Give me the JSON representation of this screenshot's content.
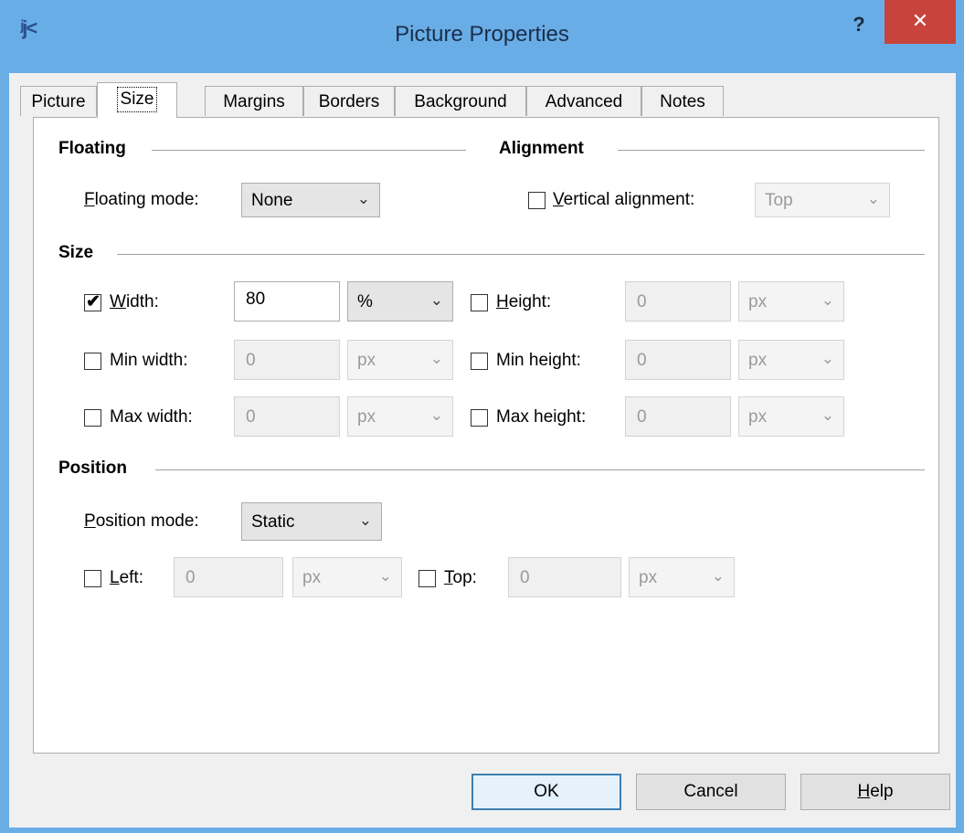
{
  "window": {
    "logo": "ʲj˂",
    "title": "Picture Properties",
    "help_glyph": "?",
    "close_glyph": "✕"
  },
  "tabs": [
    {
      "label": "Picture",
      "active": false
    },
    {
      "label": "Size",
      "active": true
    },
    {
      "label": "Margins",
      "active": false
    },
    {
      "label": "Borders",
      "active": false
    },
    {
      "label": "Background",
      "active": false
    },
    {
      "label": "Advanced",
      "active": false
    },
    {
      "label": "Notes",
      "active": false
    }
  ],
  "floating": {
    "section_title": "Floating",
    "mode_label_ul": "F",
    "mode_label_rest": "loating mode:",
    "mode_value": "None"
  },
  "alignment": {
    "section_title": "Alignment",
    "vertical_label_ul": "V",
    "vertical_label_rest": "ertical alignment:",
    "vertical_checked": false,
    "vertical_value": "Top"
  },
  "size": {
    "section_title": "Size",
    "width_label_ul": "W",
    "width_label_rest": "idth:",
    "width_checked": true,
    "width_value": "80",
    "width_unit": "%",
    "height_label_ul": "H",
    "height_label_rest": "eight:",
    "height_checked": false,
    "height_value": "0",
    "height_unit": "px",
    "min_width_label": "Min width:",
    "min_width_value": "0",
    "min_width_unit": "px",
    "min_height_label": "Min height:",
    "min_height_value": "0",
    "min_height_unit": "px",
    "max_width_label": "Max width:",
    "max_width_value": "0",
    "max_width_unit": "px",
    "max_height_label": "Max height:",
    "max_height_value": "0",
    "max_height_unit": "px"
  },
  "position": {
    "section_title": "Position",
    "mode_label_ul": "P",
    "mode_label_rest": "osition mode:",
    "mode_value": "Static",
    "left_label_ul": "L",
    "left_label_rest": "eft:",
    "left_value": "0",
    "left_unit": "px",
    "top_label_ul": "T",
    "top_label_rest": "op:",
    "top_value": "0",
    "top_unit": "px"
  },
  "buttons": {
    "ok": "OK",
    "cancel": "Cancel",
    "help_ul": "H",
    "help_rest": "elp"
  },
  "icons": {
    "chevron": "⌵",
    "check": "✔"
  }
}
